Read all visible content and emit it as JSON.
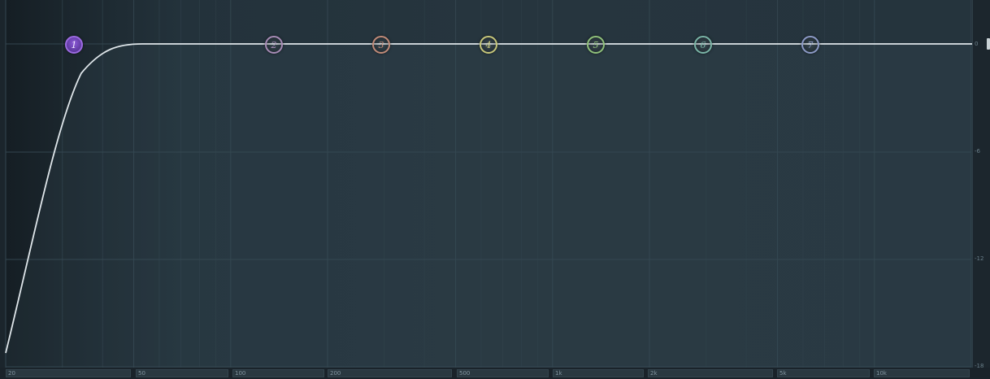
{
  "db_labels": {
    "d0": "0",
    "d6": "-6",
    "d12": "-12",
    "d18": "-18"
  },
  "bands": [
    {
      "num": "1",
      "color": "#9b6ae0",
      "active": true
    },
    {
      "num": "2",
      "color": "#a68bb5"
    },
    {
      "num": "3",
      "color": "#c08a78"
    },
    {
      "num": "4",
      "color": "#c6c67a"
    },
    {
      "num": "5",
      "color": "#8fc07a"
    },
    {
      "num": "6",
      "color": "#7ab4a6"
    },
    {
      "num": "7",
      "color": "#8c9ac6"
    }
  ],
  "freq_labels": {
    "f20": "20",
    "f50": "50",
    "f100": "100",
    "f200": "200",
    "f500": "500",
    "f1k": "1k",
    "f2k": "2k",
    "f5k": "5k",
    "f10k": "10k"
  }
}
